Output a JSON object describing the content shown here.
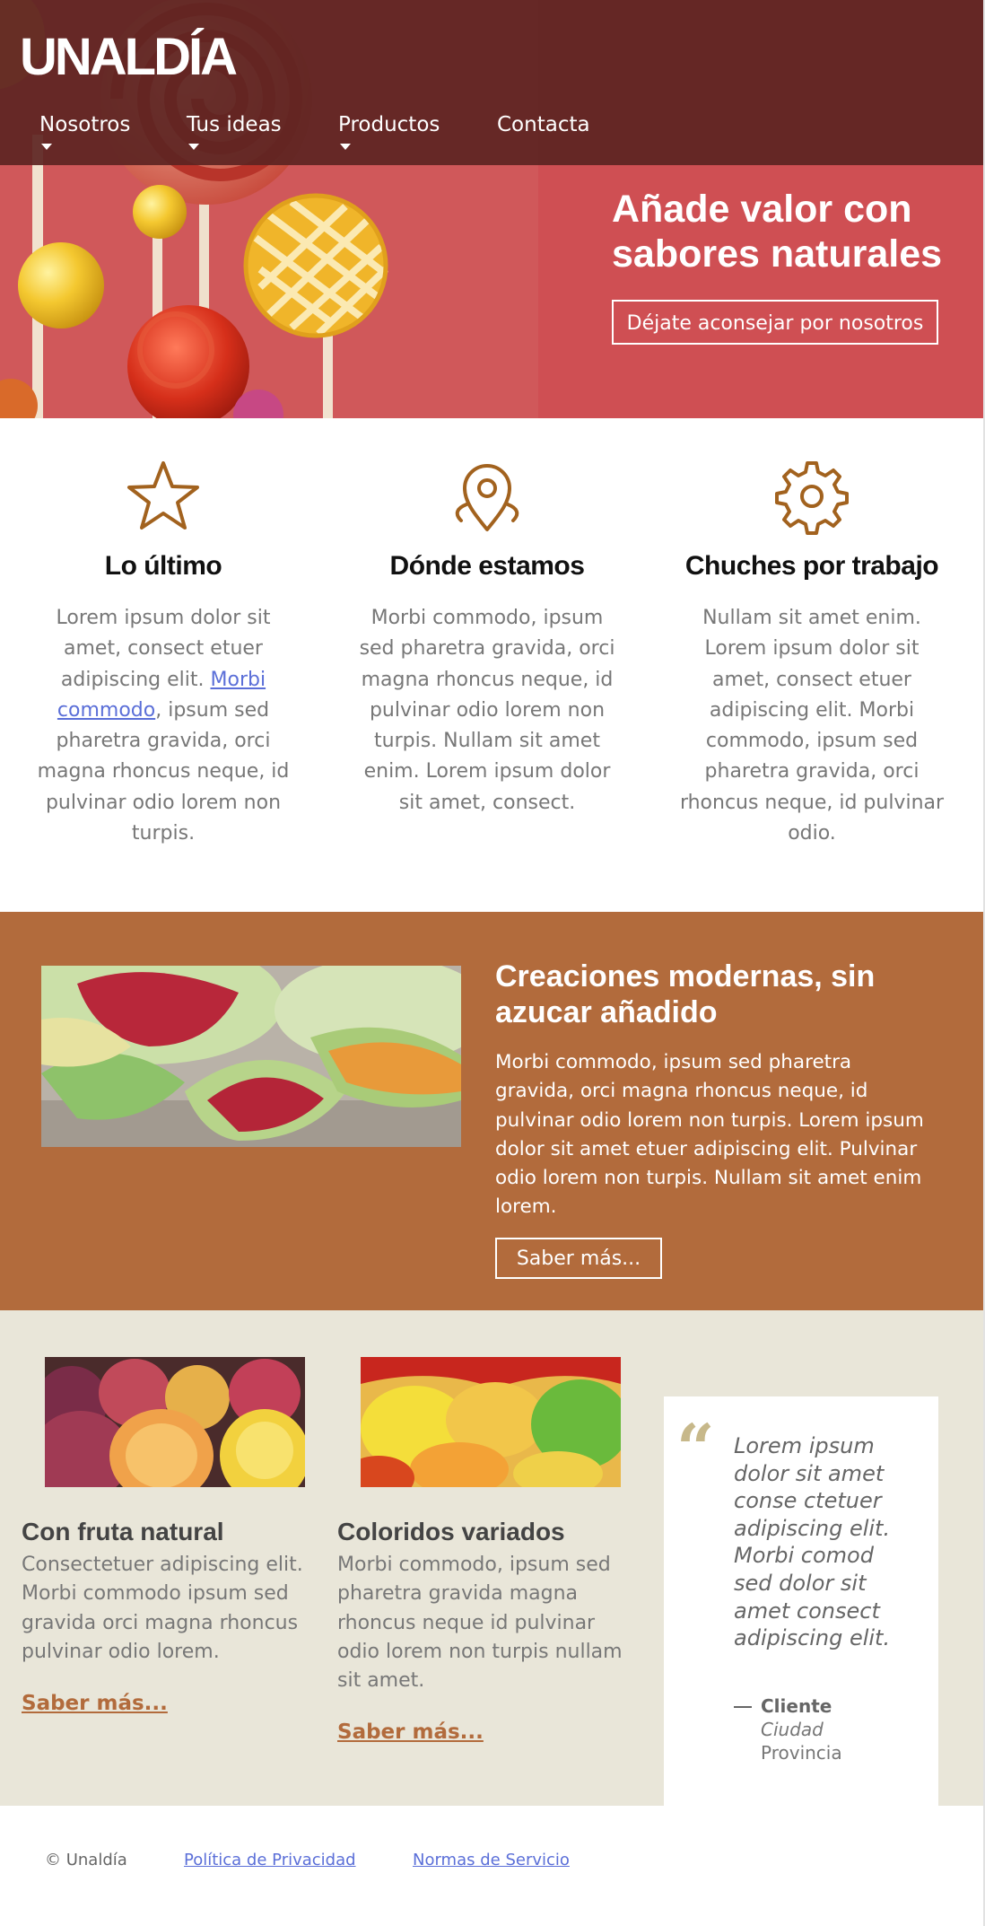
{
  "brand": {
    "logo": "UNALDÍA"
  },
  "nav": {
    "items": [
      {
        "label": "Nosotros",
        "has_dropdown": true
      },
      {
        "label": "Tus ideas",
        "has_dropdown": true
      },
      {
        "label": "Productos",
        "has_dropdown": true
      },
      {
        "label": "Contacta",
        "has_dropdown": false
      }
    ]
  },
  "hero": {
    "title": "Añade valor con sabores naturales",
    "button_label": "Déjate aconsejar por nosotros"
  },
  "features": [
    {
      "icon": "star-icon",
      "title": "Lo último",
      "text_before": "Lorem ipsum dolor sit amet, consect etuer adipiscing elit. ",
      "link": "Morbi commodo",
      "text_after": ", ipsum sed pharetra gravida, orci magna rhoncus neque, id pulvinar odio lorem non turpis."
    },
    {
      "icon": "location-pin-icon",
      "title": "Dónde estamos",
      "text": "Morbi commodo, ipsum sed pharetra gravida, orci magna rhoncus neque, id pulvinar odio lorem non turpis. Nullam sit amet enim. Lorem ipsum dolor sit amet, consect."
    },
    {
      "icon": "gear-icon",
      "title": "Chuches por trabajo",
      "text": "Nullam sit amet enim. Lorem ipsum dolor sit amet, consect etuer adipiscing elit. Morbi commodo, ipsum sed pharetra gravida, orci rhoncus neque, id pulvinar odio."
    }
  ],
  "promo": {
    "title": "Creaciones modernas, sin azucar añadido",
    "text": "Morbi commodo, ipsum sed pharetra gravida, orci magna rhoncus neque, id pulvinar odio lorem non turpis. Lorem ipsum dolor sit amet etuer adipiscing elit. Pulvinar odio lorem non turpis. Nullam sit amet enim lorem.",
    "button_label": "Saber más..."
  },
  "cards": [
    {
      "title": "Con fruta natural",
      "text": "Consectetuer adipiscing elit. Morbi commodo ipsum sed gravida orci magna rhoncus pulvinar odio lorem.",
      "link": "Saber más..."
    },
    {
      "title": "Coloridos variados",
      "text": "Morbi commodo, ipsum sed pharetra gravida magna rhoncus neque id pulvinar odio lorem non turpis nullam sit amet.",
      "link": "Saber más..."
    }
  ],
  "testimonial": {
    "quote": "Lorem ipsum dolor sit amet conse ctetuer adipiscing elit. Morbi comod sed dolor sit amet consect adipiscing elit.",
    "author": "Cliente",
    "city": "Ciudad",
    "region": "Provincia"
  },
  "footer": {
    "copyright": "© Unaldía",
    "privacy_link": "Política de Privacidad",
    "terms_link": "Normas de Servicio"
  },
  "colors": {
    "header_band": "#5c2422",
    "hero_pink": "#d0585a",
    "promo_brown": "#b26b3c",
    "icon_brown": "#a2621e",
    "beige": "#e9e6d9",
    "quote_mark": "#c7b88a",
    "link_blue": "#5b6fd8"
  }
}
